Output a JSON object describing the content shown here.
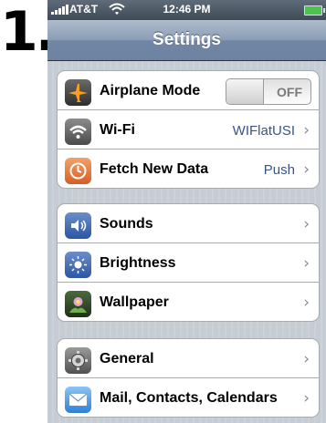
{
  "step": {
    "number": "1."
  },
  "status_bar": {
    "carrier": "AT&T",
    "time": "12:46 PM"
  },
  "nav": {
    "title": "Settings"
  },
  "groups": [
    {
      "rows": [
        {
          "label": "Airplane Mode",
          "toggle": "OFF",
          "icon": "airplane-icon"
        },
        {
          "label": "Wi-Fi",
          "value": "WIFlatUSI",
          "icon": "wifi-icon"
        },
        {
          "label": "Fetch New Data",
          "value": "Push",
          "icon": "clock-icon"
        }
      ]
    },
    {
      "rows": [
        {
          "label": "Sounds",
          "icon": "speaker-icon"
        },
        {
          "label": "Brightness",
          "icon": "sun-icon"
        },
        {
          "label": "Wallpaper",
          "icon": "flower-icon"
        }
      ]
    },
    {
      "rows": [
        {
          "label": "General",
          "icon": "gear-icon"
        },
        {
          "label": "Mail, Contacts, Calendars",
          "icon": "envelope-icon"
        }
      ]
    }
  ],
  "colors": {
    "value_text": "#385487",
    "nav_bar": "#6d83a1",
    "background": "#c5ccd4"
  }
}
